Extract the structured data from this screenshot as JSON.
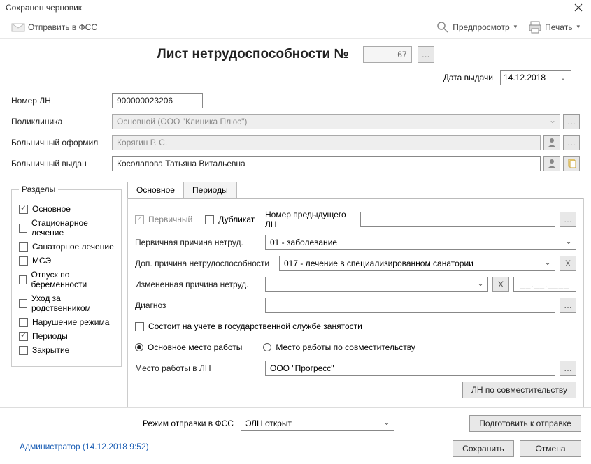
{
  "window": {
    "title": "Сохранен черновик"
  },
  "toolbar": {
    "send": "Отправить в ФСС",
    "preview": "Предпросмотр",
    "print": "Печать"
  },
  "header": {
    "title": "Лист нетрудоспособности №",
    "number": "67",
    "date_label": "Дата выдачи",
    "date_value": "14.12.2018"
  },
  "top_fields": {
    "ln_number": {
      "label": "Номер ЛН",
      "value": "900000023206"
    },
    "clinic": {
      "label": "Поликлиника",
      "value": "Основной (ООО \"Клиника Плюс\")"
    },
    "doctor": {
      "label": "Больничный оформил",
      "value": "Корягин Р. С."
    },
    "patient": {
      "label": "Больничный выдан",
      "value": "Косолапова Татьяна Витальевна"
    }
  },
  "sections": {
    "legend": "Разделы",
    "items": [
      {
        "label": "Основное",
        "checked": true
      },
      {
        "label": "Стационарное лечение",
        "checked": false
      },
      {
        "label": "Санаторное лечение",
        "checked": false
      },
      {
        "label": "МСЭ",
        "checked": false
      },
      {
        "label": "Отпуск по беременности",
        "checked": false
      },
      {
        "label": "Уход за родственником",
        "checked": false
      },
      {
        "label": "Нарушение режима",
        "checked": false
      },
      {
        "label": "Периоды",
        "checked": true
      },
      {
        "label": "Закрытие",
        "checked": false
      }
    ]
  },
  "tabs": [
    {
      "label": "Основное",
      "active": true
    },
    {
      "label": "Периоды",
      "active": false
    }
  ],
  "main": {
    "primary_chk": "Первичный",
    "duplicate_chk": "Дубликат",
    "prev_ln_label": "Номер предыдущего ЛН",
    "prev_ln_value": "",
    "reason1_label": "Первичная причина нетруд.",
    "reason1_value": "01 - заболевание",
    "reason_add_label": "Доп. причина нетрудоспособности",
    "reason_add_value": "017 - лечение в специализированном санатории",
    "x_btn": "X",
    "reason_changed_label": "Измененная причина нетруд.",
    "reason_changed_value": "",
    "dash_placeholder": "__.__.____",
    "diag_label": "Диагноз",
    "diag_value": "",
    "emp_center_chk": "Состоит на учете в государственной службе занятости",
    "work_main_radio": "Основное место работы",
    "work_side_radio": "Место работы по совместительству",
    "work_in_ln_label": "Место работы в ЛН",
    "work_in_ln_value": "ООО \"Прогресс\"",
    "ln_side_btn": "ЛН по совместительству"
  },
  "footer": {
    "mode_label": "Режим отправки в ФСС",
    "mode_value": "ЭЛН открыт",
    "prepare_btn": "Подготовить к отправке",
    "save_btn": "Сохранить",
    "cancel_btn": "Отмена"
  },
  "status": "Администратор (14.12.2018 9:52)"
}
